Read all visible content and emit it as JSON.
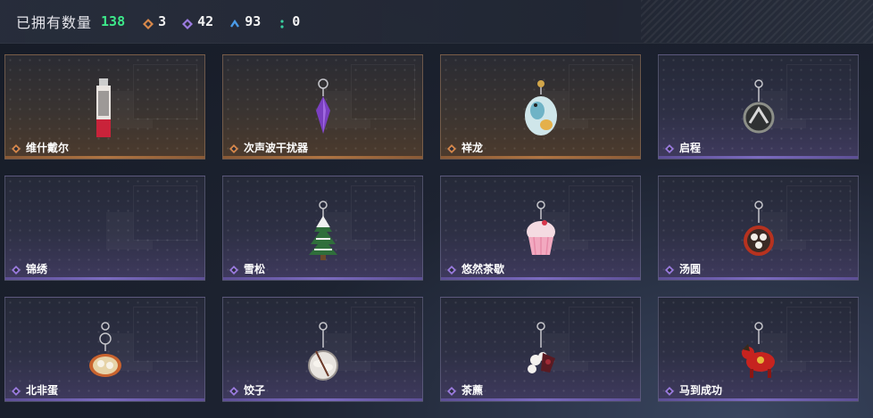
{
  "header": {
    "title": "已拥有数量",
    "total": "138",
    "stats": [
      {
        "icon": "orange-rarity-icon",
        "value": "3"
      },
      {
        "icon": "purple-rarity-icon",
        "value": "42"
      },
      {
        "icon": "blue-rarity-icon",
        "value": "93"
      },
      {
        "icon": "green-rarity-icon",
        "value": "0"
      }
    ]
  },
  "colors": {
    "orange": "#d8884a",
    "purple": "#9b7be0",
    "blue": "#4a9be8",
    "green": "#3ad0a0",
    "total_green": "#3de88a"
  },
  "items": [
    {
      "name": "维什戴尔",
      "rarity": "orange",
      "charm": "card-charm"
    },
    {
      "name": "次声波干扰器",
      "rarity": "orange",
      "charm": "crystal-charm"
    },
    {
      "name": "祥龙",
      "rarity": "orange",
      "charm": "dragon-charm"
    },
    {
      "name": "启程",
      "rarity": "purple",
      "charm": "medal-charm"
    },
    {
      "name": "锦绣",
      "rarity": "purple",
      "charm": "empty"
    },
    {
      "name": "雪松",
      "rarity": "purple",
      "charm": "pine-charm"
    },
    {
      "name": "悠然茶歇",
      "rarity": "purple",
      "charm": "cupcake-charm"
    },
    {
      "name": "汤圆",
      "rarity": "purple",
      "charm": "bowl-charm"
    },
    {
      "name": "北非蛋",
      "rarity": "purple",
      "charm": "pan-charm"
    },
    {
      "name": "饺子",
      "rarity": "purple",
      "charm": "plate-charm"
    },
    {
      "name": "茶藨",
      "rarity": "purple",
      "charm": "flower-charm"
    },
    {
      "name": "马到成功",
      "rarity": "purple",
      "charm": "horse-charm"
    }
  ]
}
